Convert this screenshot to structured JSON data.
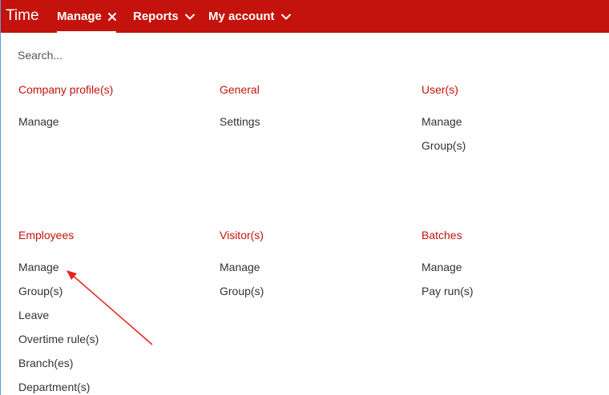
{
  "nav": {
    "brand": "Time",
    "items": [
      {
        "label": "Manage",
        "icon": "close-icon"
      },
      {
        "label": "Reports",
        "icon": "chevron-down-icon"
      },
      {
        "label": "My account",
        "icon": "chevron-down-icon"
      }
    ]
  },
  "search": {
    "placeholder": "Search..."
  },
  "sections": [
    {
      "title": "Company profile(s)",
      "links": [
        "Manage"
      ]
    },
    {
      "title": "General",
      "links": [
        "Settings"
      ]
    },
    {
      "title": "User(s)",
      "links": [
        "Manage",
        "Group(s)"
      ]
    },
    {
      "title": "Employees",
      "links": [
        "Manage",
        "Group(s)",
        "Leave",
        "Overtime rule(s)",
        "Branch(es)",
        "Department(s)"
      ]
    },
    {
      "title": "Visitor(s)",
      "links": [
        "Manage",
        "Group(s)"
      ]
    },
    {
      "title": "Batches",
      "links": [
        "Manage",
        "Pay run(s)"
      ]
    }
  ],
  "colors": {
    "brand_red": "#c4120c",
    "annotation_arrow": "#e8231b"
  }
}
